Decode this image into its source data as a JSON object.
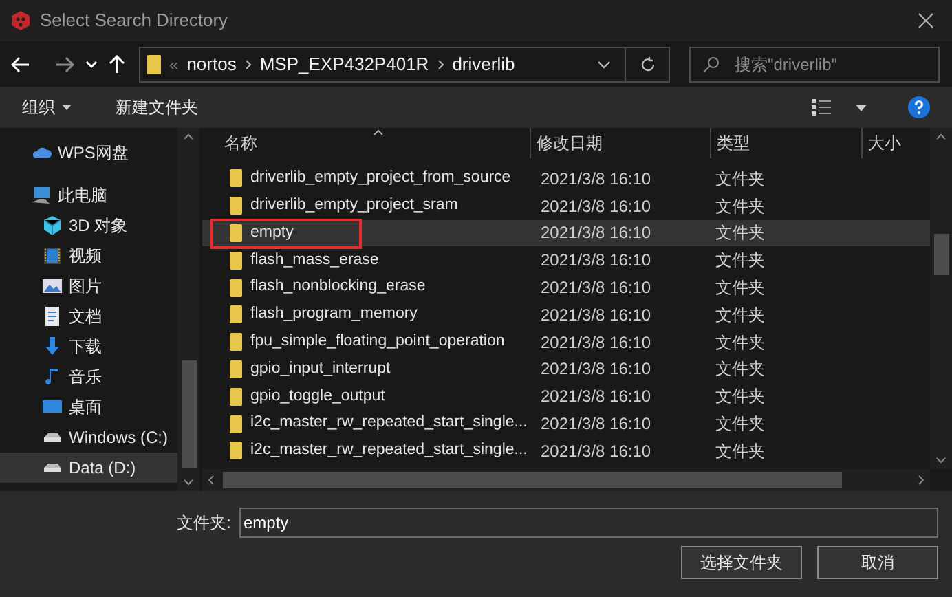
{
  "window": {
    "title": "Select Search Directory"
  },
  "address_bar": {
    "overflow": "«",
    "path": [
      "nortos",
      "MSP_EXP432P401R",
      "driverlib"
    ]
  },
  "search": {
    "placeholder": "搜索\"driverlib\""
  },
  "toolbar": {
    "organize": "组织",
    "new_folder": "新建文件夹"
  },
  "sidebar": {
    "items": [
      {
        "label": "WPS网盘",
        "kind": "cloud",
        "selected": false
      },
      {
        "label": "此电脑",
        "kind": "pc",
        "selected": false,
        "children": [
          {
            "label": "3D 对象",
            "kind": "cube",
            "selected": false
          },
          {
            "label": "视频",
            "kind": "video",
            "selected": false
          },
          {
            "label": "图片",
            "kind": "picture",
            "selected": false
          },
          {
            "label": "文档",
            "kind": "document",
            "selected": false
          },
          {
            "label": "下载",
            "kind": "download",
            "selected": false
          },
          {
            "label": "音乐",
            "kind": "music",
            "selected": false
          },
          {
            "label": "桌面",
            "kind": "desktop",
            "selected": false
          },
          {
            "label": "Windows (C:)",
            "kind": "drive",
            "selected": false
          },
          {
            "label": "Data (D:)",
            "kind": "drive",
            "selected": true
          }
        ]
      }
    ]
  },
  "table": {
    "columns": [
      "名称",
      "修改日期",
      "类型",
      "大小"
    ],
    "rows": [
      {
        "name": "driverlib_empty_project_from_source",
        "date": "2021/3/8 16:10",
        "type": "文件夹",
        "selected": false,
        "outlined": false
      },
      {
        "name": "driverlib_empty_project_sram",
        "date": "2021/3/8 16:10",
        "type": "文件夹",
        "selected": false,
        "outlined": false
      },
      {
        "name": "empty",
        "date": "2021/3/8 16:10",
        "type": "文件夹",
        "selected": true,
        "outlined": true
      },
      {
        "name": "flash_mass_erase",
        "date": "2021/3/8 16:10",
        "type": "文件夹",
        "selected": false,
        "outlined": false
      },
      {
        "name": "flash_nonblocking_erase",
        "date": "2021/3/8 16:10",
        "type": "文件夹",
        "selected": false,
        "outlined": false
      },
      {
        "name": "flash_program_memory",
        "date": "2021/3/8 16:10",
        "type": "文件夹",
        "selected": false,
        "outlined": false
      },
      {
        "name": "fpu_simple_floating_point_operation",
        "date": "2021/3/8 16:10",
        "type": "文件夹",
        "selected": false,
        "outlined": false
      },
      {
        "name": "gpio_input_interrupt",
        "date": "2021/3/8 16:10",
        "type": "文件夹",
        "selected": false,
        "outlined": false
      },
      {
        "name": "gpio_toggle_output",
        "date": "2021/3/8 16:10",
        "type": "文件夹",
        "selected": false,
        "outlined": false
      },
      {
        "name": "i2c_master_rw_repeated_start_single...",
        "date": "2021/3/8 16:10",
        "type": "文件夹",
        "selected": false,
        "outlined": false
      },
      {
        "name": "i2c_master_rw_repeated_start_single...",
        "date": "2021/3/8 16:10",
        "type": "文件夹",
        "selected": false,
        "outlined": false
      }
    ]
  },
  "folder_field": {
    "label": "文件夹:",
    "value": "empty"
  },
  "buttons": [
    "选择文件夹",
    "取消"
  ]
}
